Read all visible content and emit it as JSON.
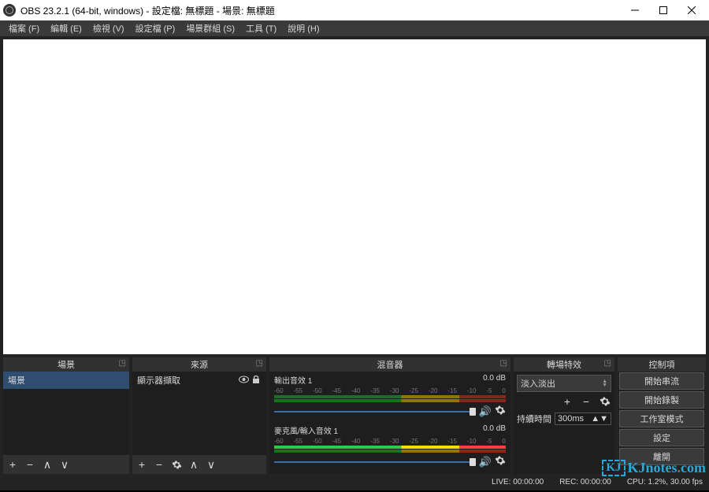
{
  "window": {
    "title": "OBS 23.2.1 (64-bit, windows) - 設定檔: 無標題 - 場景: 無標題"
  },
  "menu": {
    "file": "檔案 (F)",
    "edit": "編輯 (E)",
    "view": "檢視 (V)",
    "profile": "設定檔 (P)",
    "sceneCollection": "場景群組 (S)",
    "tools": "工具 (T)",
    "help": "說明 (H)"
  },
  "panels": {
    "scenes": {
      "title": "場景",
      "items": [
        "場景"
      ]
    },
    "sources": {
      "title": "來源",
      "items": [
        "顯示器擷取"
      ]
    },
    "mixer": {
      "title": "混音器",
      "tracks": [
        {
          "name": "輸出音效 1",
          "level": "0.0 dB"
        },
        {
          "name": "麥克風/輸入音效 1",
          "level": "0.0 dB"
        }
      ],
      "ticks": [
        "-60",
        "-55",
        "-50",
        "-45",
        "-40",
        "-35",
        "-30",
        "-25",
        "-20",
        "-15",
        "-10",
        "-5",
        "0"
      ]
    },
    "transitions": {
      "title": "轉場特效",
      "selected": "淡入淡出",
      "durationLabel": "持續時間",
      "durationValue": "300ms"
    },
    "controls": {
      "title": "控制項",
      "buttons": {
        "stream": "開始串流",
        "record": "開始錄製",
        "studio": "工作室模式",
        "settings": "設定",
        "exit": "離開"
      }
    }
  },
  "status": {
    "live": "LIVE: 00:00:00",
    "rec": "REC: 00:00:00",
    "cpu": "CPU: 1.2%, 30.00 fps"
  },
  "watermark": {
    "logo": "KJ",
    "text1": "KJnotes",
    "dot": ".",
    "text2": "com"
  }
}
